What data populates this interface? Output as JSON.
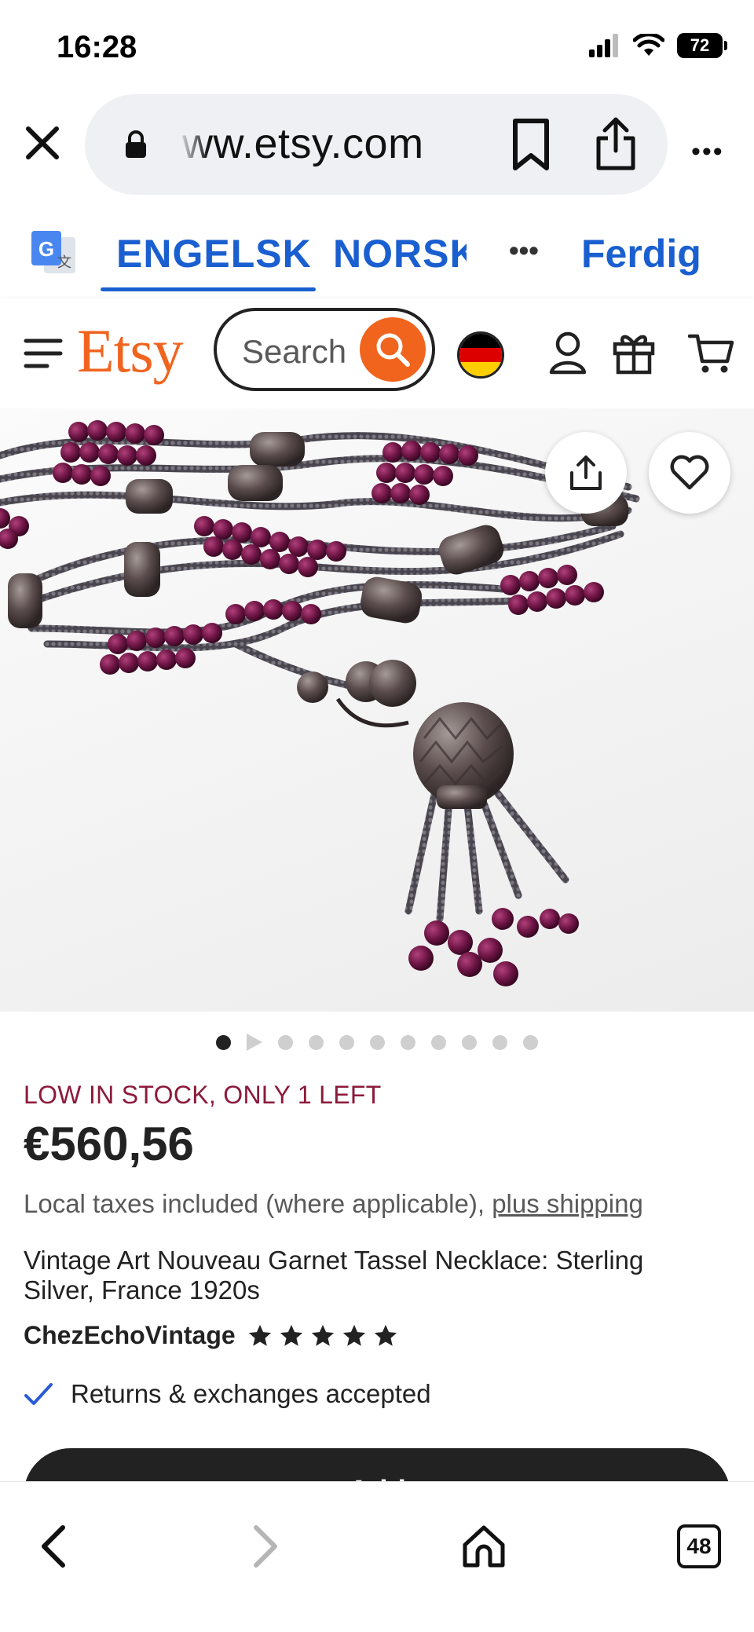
{
  "status_bar": {
    "time": "16:28",
    "battery": "72"
  },
  "browser": {
    "url": "ww.etsy.com",
    "icons": {
      "close": "close-icon",
      "lock": "lock-icon",
      "bookmark": "bookmark-icon",
      "share": "share-icon",
      "more": "more-icon"
    },
    "more_label": "•••"
  },
  "translate": {
    "tab_active": "ENGELSK",
    "tab_other": "NORSK",
    "more_label": "•••",
    "done": "Ferdig",
    "accent": "#1a5fd0"
  },
  "etsy_header": {
    "logo": "Etsy",
    "search_placeholder": "Search",
    "brand_color": "#f1641e",
    "icons": [
      "menu-icon",
      "search-icon",
      "flag-de-icon",
      "user-icon",
      "gift-icon",
      "cart-icon"
    ]
  },
  "gallery": {
    "total_dots": 11,
    "active_index": 0,
    "video_index": 1
  },
  "product": {
    "stock": "LOW IN STOCK, ONLY 1 LEFT",
    "price": "€560,56",
    "taxes_text": "Local taxes included (where applicable), ",
    "shipping_link": "plus shipping",
    "title": "Vintage Art Nouveau Garnet Tassel Necklace: Sterling Silver, France 1920s",
    "shop": "ChezEchoVintage",
    "rating_stars": 5,
    "returns": "Returns & exchanges accepted",
    "add_button": "Add"
  },
  "toolbar": {
    "tabs_count": "48"
  }
}
